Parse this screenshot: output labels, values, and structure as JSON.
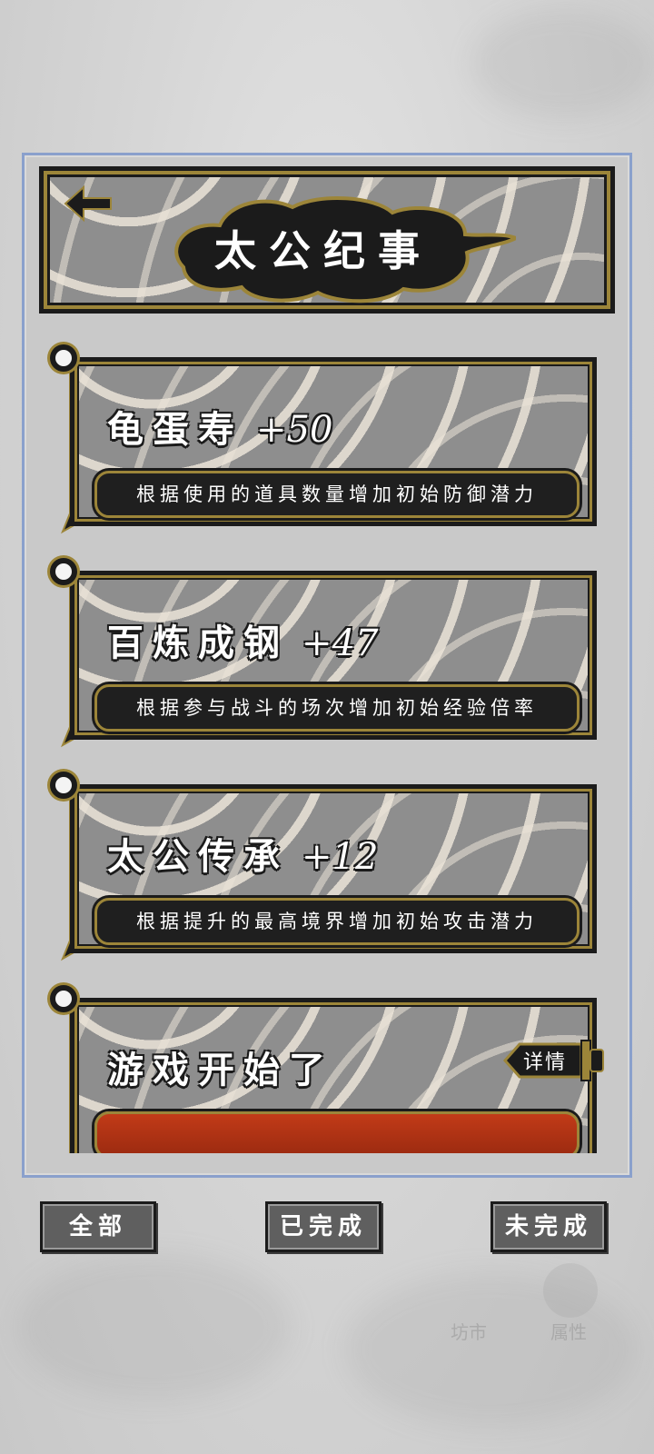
{
  "header": {
    "title": "太公纪事"
  },
  "achievements": [
    {
      "name": "龟蛋寿",
      "bonus": "+50",
      "description": "根据使用的道具数量增加初始防御潜力"
    },
    {
      "name": "百炼成钢",
      "bonus": "+47",
      "description": "根据参与战斗的场次增加初始经验倍率"
    },
    {
      "name": "太公传承",
      "bonus": "+12",
      "description": "根据提升的最高境界增加初始攻击潜力"
    },
    {
      "name": "游戏开始了",
      "bonus": "",
      "detail_label": "详情"
    }
  ],
  "filters": {
    "all": "全部",
    "completed": "已完成",
    "incomplete": "未完成"
  },
  "bottom_nav": {
    "market": "坊市",
    "attributes": "属性"
  },
  "colors": {
    "accent_gold": "#9c8539",
    "ink": "#1b1b1b",
    "panel_border": "#8aa0cc",
    "progress_red": "#c23b18"
  }
}
